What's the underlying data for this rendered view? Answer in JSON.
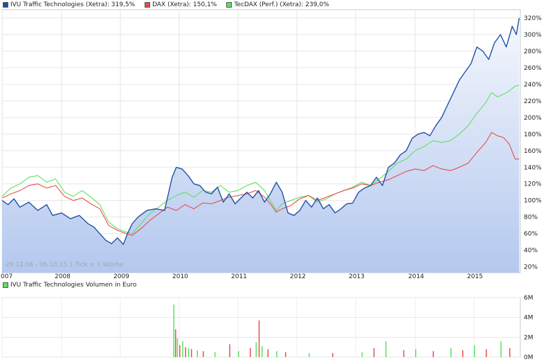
{
  "legend": [
    {
      "label": "IVU Traffic Technologies (Xetra): 319,5%",
      "color": "#1f4fa8"
    },
    {
      "label": "DAX (Xetra): 150,1%",
      "color": "#e84c4c"
    },
    {
      "label": "TecDAX (Perf.) (Xetra): 239,0%",
      "color": "#5ee05e"
    }
  ],
  "range_note": "29.12.06 - 06.10.15   1 Tick = 1 Woche",
  "volume_legend": {
    "label": "IVU Traffic Technologies Volumen in Euro",
    "color": "#5ee05e"
  },
  "chart_data": [
    {
      "type": "line",
      "title": "",
      "x_ticks": [
        "007",
        "2008",
        "2009",
        "2010",
        "2011",
        "2012",
        "2013",
        "2014",
        "2015"
      ],
      "y_ticks": [
        "20%",
        "40%",
        "60%",
        "80%",
        "100%",
        "120%",
        "140%",
        "160%",
        "180%",
        "200%",
        "220%",
        "240%",
        "260%",
        "280%",
        "300%",
        "320%"
      ],
      "ylim": [
        13,
        330
      ],
      "xlim": [
        2007.0,
        2015.77
      ],
      "grid": true,
      "series": [
        {
          "name": "IVU Traffic Technologies (Xetra)",
          "color": "#1f4fa8",
          "fill": true,
          "x": [
            2007.0,
            2007.1,
            2007.2,
            2007.3,
            2007.45,
            2007.6,
            2007.75,
            2007.85,
            2008.0,
            2008.15,
            2008.3,
            2008.45,
            2008.55,
            2008.65,
            2008.75,
            2008.85,
            2008.95,
            2009.05,
            2009.12,
            2009.2,
            2009.3,
            2009.45,
            2009.6,
            2009.75,
            2009.88,
            2009.95,
            2010.05,
            2010.15,
            2010.25,
            2010.35,
            2010.45,
            2010.55,
            2010.65,
            2010.75,
            2010.85,
            2010.95,
            2011.05,
            2011.15,
            2011.25,
            2011.35,
            2011.45,
            2011.55,
            2011.65,
            2011.75,
            2011.85,
            2011.95,
            2012.05,
            2012.15,
            2012.25,
            2012.35,
            2012.45,
            2012.55,
            2012.65,
            2012.75,
            2012.85,
            2012.95,
            2013.05,
            2013.15,
            2013.25,
            2013.35,
            2013.45,
            2013.55,
            2013.65,
            2013.75,
            2013.85,
            2013.95,
            2014.05,
            2014.15,
            2014.25,
            2014.35,
            2014.45,
            2014.55,
            2014.65,
            2014.75,
            2014.85,
            2014.95,
            2015.05,
            2015.15,
            2015.25,
            2015.35,
            2015.45,
            2015.55,
            2015.65,
            2015.72,
            2015.77
          ],
          "y": [
            100,
            95,
            102,
            92,
            98,
            88,
            95,
            82,
            85,
            78,
            82,
            72,
            68,
            60,
            52,
            48,
            55,
            47,
            60,
            72,
            80,
            88,
            90,
            88,
            128,
            140,
            138,
            130,
            120,
            118,
            110,
            108,
            116,
            98,
            108,
            96,
            103,
            110,
            103,
            112,
            98,
            108,
            122,
            110,
            85,
            82,
            88,
            100,
            92,
            103,
            90,
            95,
            85,
            90,
            96,
            97,
            110,
            115,
            118,
            128,
            118,
            140,
            145,
            155,
            160,
            175,
            180,
            182,
            178,
            190,
            200,
            215,
            230,
            245,
            255,
            265,
            285,
            280,
            270,
            290,
            300,
            285,
            310,
            300,
            320
          ]
        },
        {
          "name": "DAX (Xetra)",
          "color": "#e84c4c",
          "fill": false,
          "x": [
            2007.0,
            2007.15,
            2007.3,
            2007.45,
            2007.6,
            2007.75,
            2007.9,
            2008.05,
            2008.2,
            2008.35,
            2008.5,
            2008.65,
            2008.8,
            2008.95,
            2009.1,
            2009.2,
            2009.35,
            2009.5,
            2009.65,
            2009.8,
            2009.95,
            2010.1,
            2010.25,
            2010.4,
            2010.55,
            2010.7,
            2010.85,
            2011.0,
            2011.15,
            2011.3,
            2011.45,
            2011.55,
            2011.65,
            2011.75,
            2011.9,
            2012.05,
            2012.2,
            2012.35,
            2012.5,
            2012.65,
            2012.8,
            2012.95,
            2013.1,
            2013.25,
            2013.4,
            2013.55,
            2013.7,
            2013.85,
            2014.0,
            2014.15,
            2014.3,
            2014.45,
            2014.6,
            2014.75,
            2014.9,
            2015.05,
            2015.2,
            2015.3,
            2015.4,
            2015.5,
            2015.6,
            2015.7,
            2015.77
          ],
          "y": [
            103,
            108,
            112,
            118,
            120,
            115,
            118,
            105,
            100,
            103,
            96,
            90,
            70,
            64,
            60,
            58,
            66,
            76,
            84,
            92,
            88,
            95,
            90,
            97,
            96,
            100,
            104,
            106,
            108,
            112,
            104,
            96,
            86,
            90,
            94,
            102,
            106,
            100,
            104,
            108,
            112,
            115,
            120,
            118,
            122,
            125,
            130,
            135,
            138,
            136,
            142,
            138,
            136,
            140,
            145,
            158,
            170,
            182,
            178,
            176,
            168,
            150,
            150
          ]
        },
        {
          "name": "TecDAX (Perf.)",
          "color": "#5ee05e",
          "fill": false,
          "x": [
            2007.0,
            2007.15,
            2007.3,
            2007.45,
            2007.6,
            2007.75,
            2007.9,
            2008.05,
            2008.2,
            2008.35,
            2008.5,
            2008.65,
            2008.8,
            2008.95,
            2009.1,
            2009.2,
            2009.35,
            2009.5,
            2009.65,
            2009.8,
            2009.95,
            2010.1,
            2010.25,
            2010.4,
            2010.55,
            2010.7,
            2010.85,
            2011.0,
            2011.15,
            2011.3,
            2011.45,
            2011.55,
            2011.65,
            2011.75,
            2011.9,
            2012.05,
            2012.2,
            2012.35,
            2012.5,
            2012.65,
            2012.8,
            2012.95,
            2013.1,
            2013.25,
            2013.4,
            2013.55,
            2013.7,
            2013.85,
            2014.0,
            2014.15,
            2014.3,
            2014.45,
            2014.6,
            2014.75,
            2014.9,
            2015.05,
            2015.2,
            2015.3,
            2015.4,
            2015.5,
            2015.6,
            2015.7,
            2015.77
          ],
          "y": [
            105,
            115,
            120,
            128,
            130,
            122,
            126,
            110,
            105,
            112,
            104,
            95,
            74,
            66,
            62,
            60,
            72,
            84,
            92,
            100,
            106,
            110,
            104,
            112,
            110,
            118,
            110,
            112,
            118,
            122,
            112,
            100,
            88,
            96,
            100,
            104,
            106,
            98,
            102,
            108,
            112,
            116,
            122,
            118,
            126,
            135,
            145,
            150,
            160,
            165,
            172,
            170,
            172,
            180,
            190,
            205,
            218,
            230,
            225,
            228,
            232,
            238,
            239
          ]
        }
      ]
    },
    {
      "type": "bar",
      "title": "IVU Traffic Technologies Volumen in Euro",
      "y_ticks": [
        "0M",
        "2M",
        "4M",
        "6M"
      ],
      "ylim": [
        0,
        6
      ],
      "xlim": [
        2007.0,
        2015.77
      ],
      "grid": true,
      "series": [
        {
          "name": "IVU Traffic Technologies Volumen in Euro",
          "colors": [
            "#5ee05e",
            "#e84c4c"
          ],
          "x": [
            2009.9,
            2009.93,
            2009.96,
            2010.0,
            2010.05,
            2010.1,
            2010.15,
            2010.2,
            2010.3,
            2010.4,
            2010.6,
            2010.85,
            2011.0,
            2011.2,
            2011.3,
            2011.35,
            2011.4,
            2011.5,
            2011.65,
            2011.8,
            2012.2,
            2012.6,
            2013.1,
            2013.3,
            2013.5,
            2013.8,
            2014.0,
            2014.3,
            2014.6,
            2014.8,
            2015.0,
            2015.2,
            2015.45,
            2015.6
          ],
          "values": [
            5.3,
            2.8,
            1.9,
            1.2,
            1.6,
            1.0,
            0.9,
            0.8,
            0.7,
            0.6,
            0.5,
            1.3,
            0.6,
            0.9,
            1.5,
            3.7,
            1.1,
            0.8,
            0.6,
            0.5,
            0.4,
            0.4,
            0.5,
            0.9,
            1.6,
            0.7,
            0.8,
            0.6,
            0.9,
            0.7,
            1.2,
            0.8,
            1.6,
            0.9
          ]
        }
      ]
    }
  ]
}
